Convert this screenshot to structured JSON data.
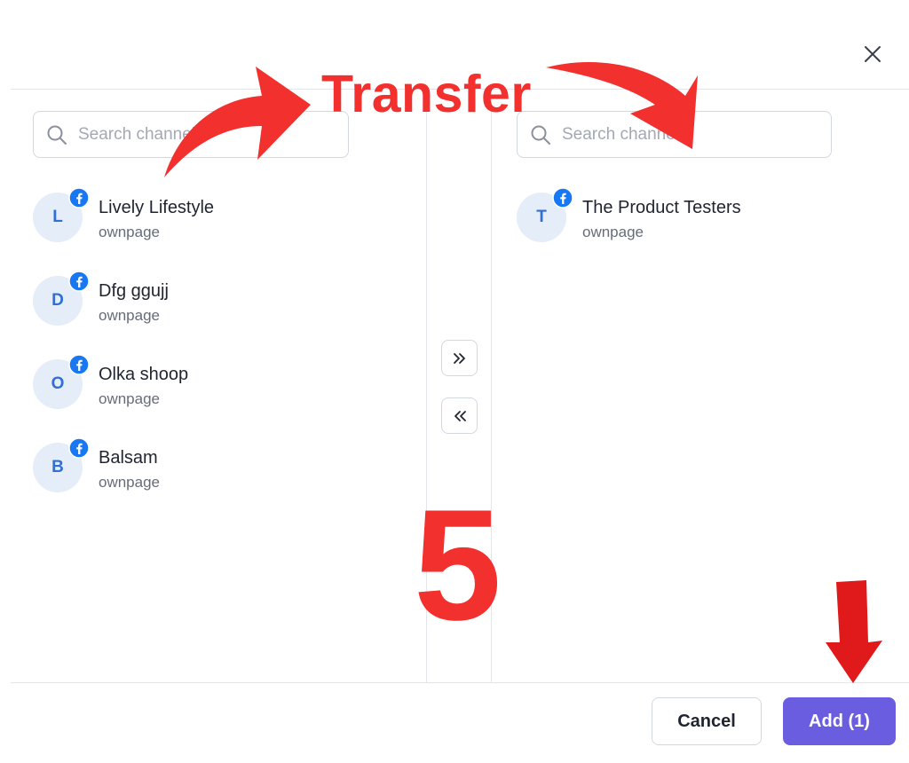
{
  "dialog": {
    "close_icon": "close-icon",
    "cancel_label": "Cancel",
    "add_label": "Add (1)",
    "accent_color": "#6a5ddf"
  },
  "left_panel": {
    "search_placeholder": "Search channels",
    "items": [
      {
        "initial": "L",
        "name": "Lively Lifestyle",
        "sub": "ownpage",
        "badge_icon": "facebook-icon"
      },
      {
        "initial": "D",
        "name": "Dfg ggujj",
        "sub": "ownpage",
        "badge_icon": "facebook-icon"
      },
      {
        "initial": "O",
        "name": "Olka shoop",
        "sub": "ownpage",
        "badge_icon": "facebook-icon"
      },
      {
        "initial": "B",
        "name": "Balsam",
        "sub": "ownpage",
        "badge_icon": "facebook-icon"
      }
    ]
  },
  "right_panel": {
    "search_placeholder": "Search channels",
    "items": [
      {
        "initial": "T",
        "name": "The Product Testers",
        "sub": "ownpage",
        "badge_icon": "facebook-icon"
      }
    ]
  },
  "transfer": {
    "move_right_icon": "double-chevron-right-icon",
    "move_left_icon": "double-chevron-left-icon"
  },
  "annotations": {
    "transfer_label": "Transfer",
    "step_number": "5",
    "annotation_color": "#f2302e"
  }
}
